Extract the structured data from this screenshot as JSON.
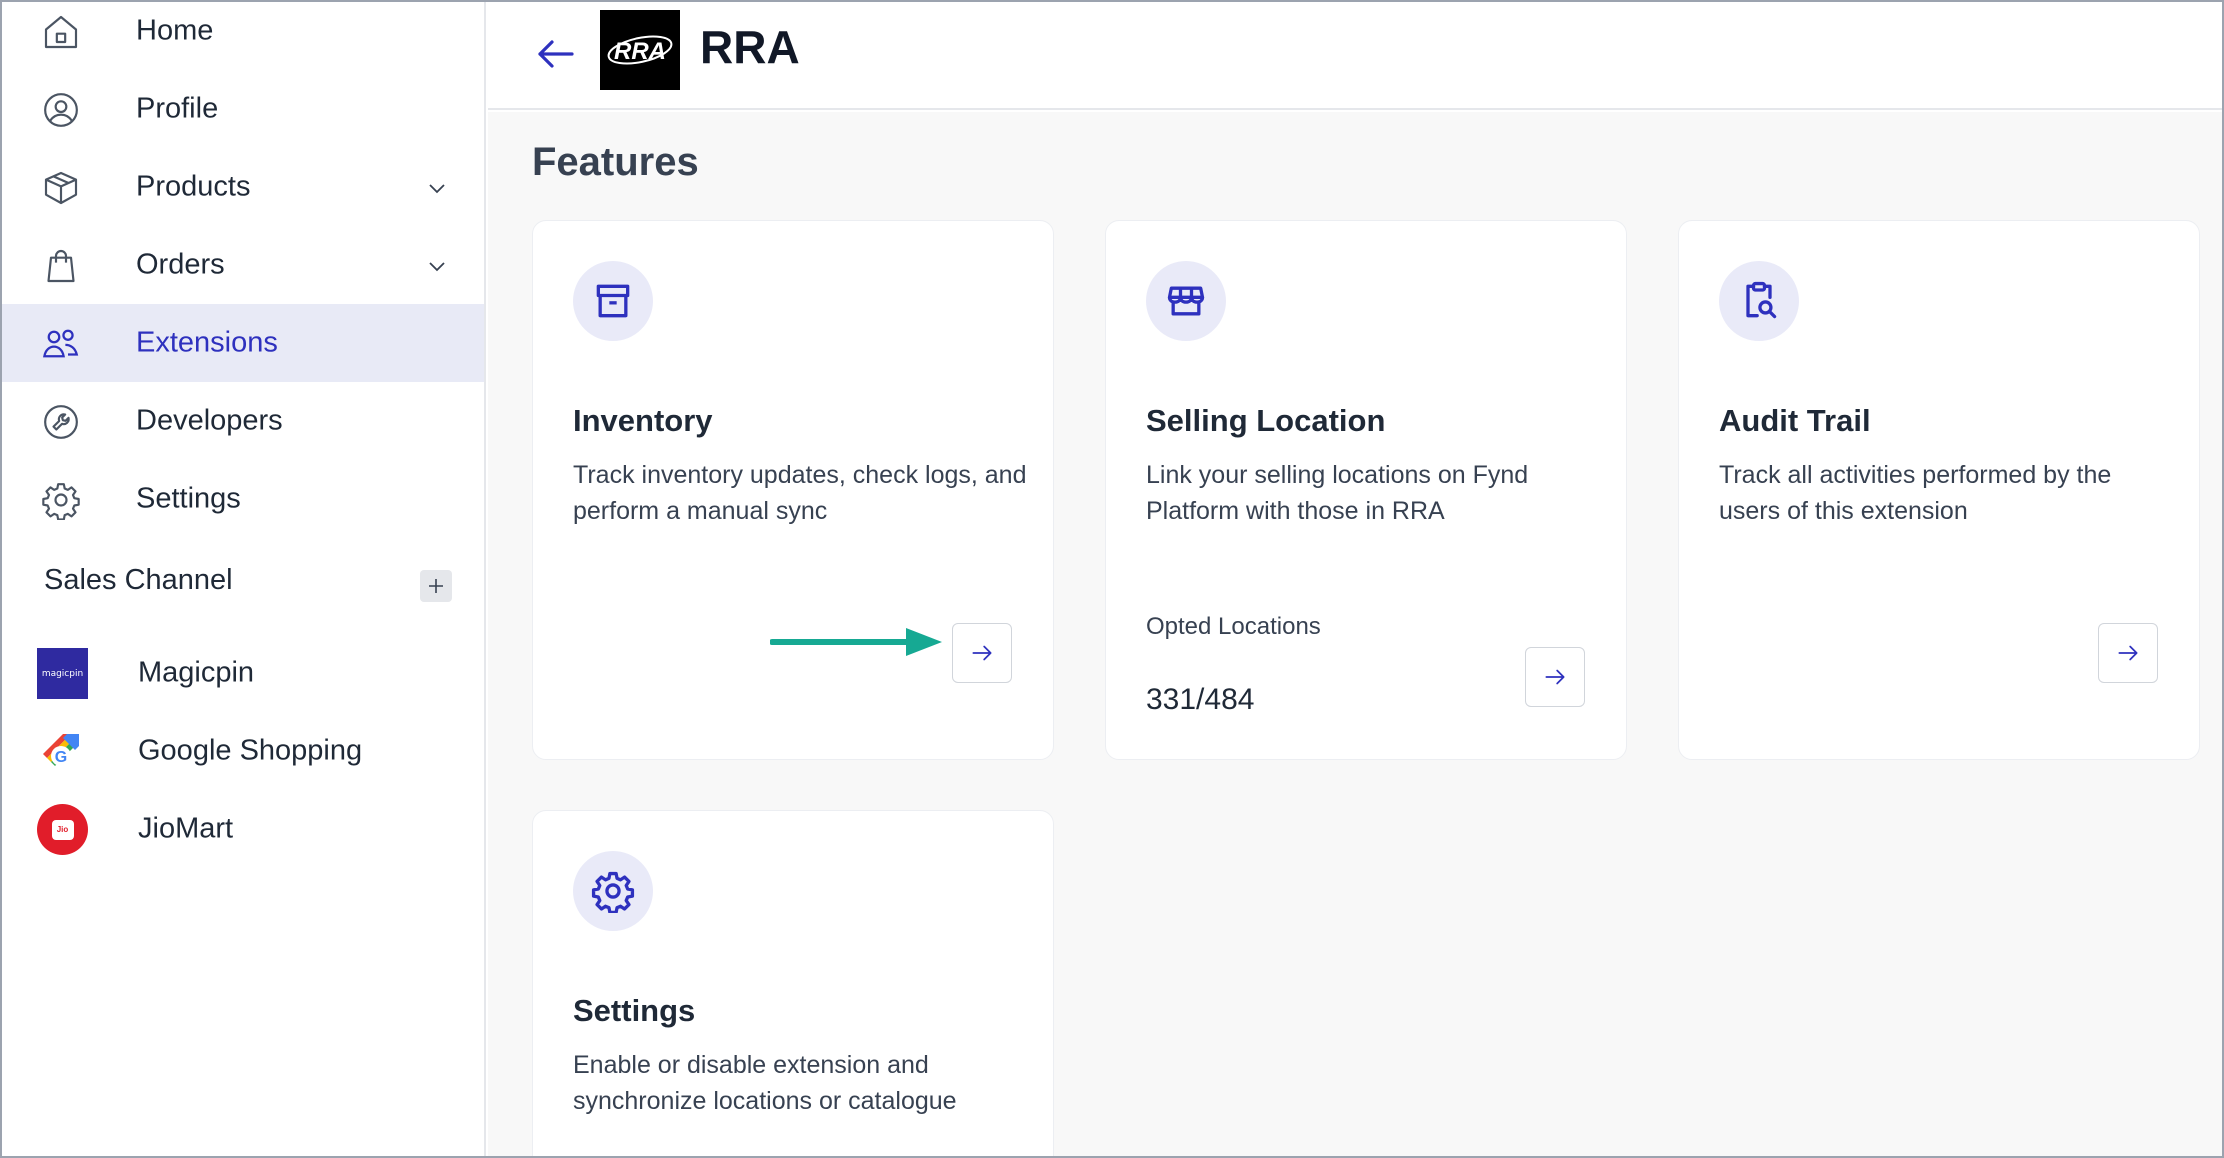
{
  "sidebar": {
    "items": [
      {
        "label": "Home",
        "icon": "home-icon"
      },
      {
        "label": "Profile",
        "icon": "user-circle-icon"
      },
      {
        "label": "Products",
        "icon": "box-icon"
      },
      {
        "label": "Orders",
        "icon": "shopping-bag-icon"
      },
      {
        "label": "Extensions",
        "icon": "users-icon"
      },
      {
        "label": "Developers",
        "icon": "wrench-icon"
      },
      {
        "label": "Settings",
        "icon": "gear-icon"
      }
    ],
    "active": "Extensions",
    "sales_channel_label": "Sales Channel",
    "channels": [
      {
        "label": "Magicpin",
        "logo_text": "magicpin"
      },
      {
        "label": "Google Shopping",
        "logo_text": "G"
      },
      {
        "label": "JioMart",
        "logo_text": "Jio"
      }
    ]
  },
  "header": {
    "title": "RRA",
    "logo_text": "RRA"
  },
  "main": {
    "section_title": "Features",
    "cards": [
      {
        "title": "Inventory",
        "description": "Track inventory updates, check logs, and perform a manual sync",
        "icon": "archive-icon"
      },
      {
        "title": "Selling Location",
        "description": "Link your selling locations on Fynd Platform with those in RRA",
        "meta_label": "Opted Locations",
        "meta_value": "331/484",
        "icon": "store-icon"
      },
      {
        "title": "Audit Trail",
        "description": "Track all activities performed by the users of this extension",
        "icon": "clipboard-search-icon"
      },
      {
        "title": "Settings",
        "description": "Enable or disable extension and synchronize locations or catalogue",
        "icon": "gear-icon"
      }
    ]
  },
  "colors": {
    "accent": "#2e31be",
    "active_bg": "#e8eaf6",
    "badge_bg": "#e9eaf8",
    "annotation_arrow": "#16a993",
    "magicpin_bg": "#2f2aa0",
    "jiomart_bg": "#e11d2a"
  }
}
